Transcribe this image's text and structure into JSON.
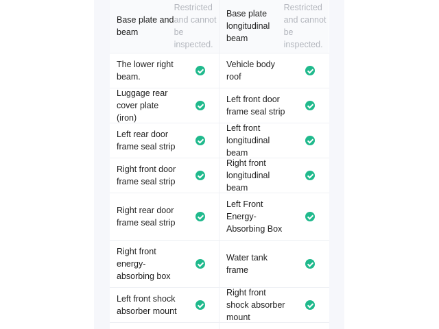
{
  "rows": [
    {
      "left": {
        "label": "Base plate and beam",
        "note": "Restricted and cannot be inspected."
      },
      "right": {
        "label": "Base plate longitudinal beam",
        "note": "Restricted and cannot be inspected."
      }
    },
    {
      "left": {
        "label": "The lower right beam.",
        "status": "check-circle-icon"
      },
      "right": {
        "label": "Vehicle body roof",
        "status": "check-circle-icon"
      }
    },
    {
      "left": {
        "label": "Luggage rear cover plate (iron)",
        "status": "check-circle-icon"
      },
      "right": {
        "label": "Left front door frame seal strip",
        "status": "check-circle-icon"
      }
    },
    {
      "left": {
        "label": "Left rear door frame seal strip",
        "status": "check-circle-icon"
      },
      "right": {
        "label": "Left front longitudinal beam",
        "status": "check-circle-icon"
      }
    },
    {
      "left": {
        "label": "Right front door frame seal strip",
        "status": "check-circle-icon"
      },
      "right": {
        "label": "Right front longitudinal beam",
        "status": "check-circle-icon"
      }
    },
    {
      "left": {
        "label": "Right rear door frame seal strip",
        "status": "check-circle-icon"
      },
      "right": {
        "label": "Left Front Energy-Absorbing Box",
        "status": "check-circle-icon"
      }
    },
    {
      "left": {
        "label": "Right front energy-absorbing box",
        "status": "check-circle-icon"
      },
      "right": {
        "label": "Water tank frame",
        "status": "check-circle-icon"
      }
    },
    {
      "left": {
        "label": "Left front shock absorber mount",
        "status": "check-circle-icon"
      },
      "right": {
        "label": "Right front shock absorber mount",
        "status": "check-circle-icon"
      }
    }
  ],
  "colors": {
    "check": "#1fb98c",
    "note": "#b3b6bd",
    "text": "#1f1f1f",
    "panel": "#f6f7fb"
  }
}
